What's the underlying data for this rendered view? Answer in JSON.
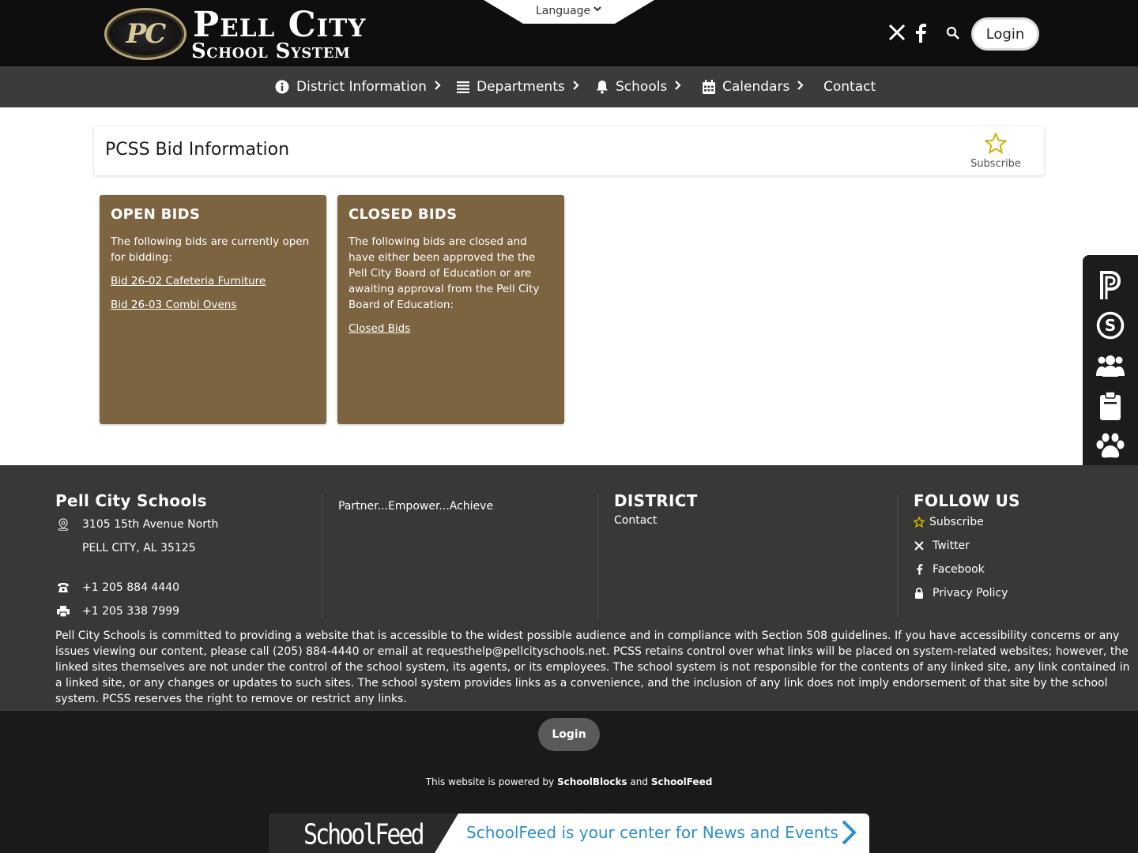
{
  "header": {
    "logo_line1": "Pell City",
    "logo_line2": "School System",
    "logo_seal_text": "PC",
    "language_label": "Language",
    "login_label": "Login"
  },
  "nav": {
    "items": [
      {
        "label": "District Information",
        "icon": "info-circle-icon"
      },
      {
        "label": "Departments",
        "icon": "list-icon"
      },
      {
        "label": "Schools",
        "icon": "bell-icon"
      },
      {
        "label": "Calendars",
        "icon": "calendar-icon"
      },
      {
        "label": "Contact",
        "icon": ""
      }
    ]
  },
  "page": {
    "title": "PCSS Bid Information",
    "subscribe_label": "Subscribe"
  },
  "blocks": [
    {
      "title": "OPEN BIDS",
      "text": "The following bids are currently open for bidding:",
      "links": [
        "Bid 26-02 Cafeteria Furniture",
        "Bid 26-03 Combi Ovens"
      ]
    },
    {
      "title": "CLOSED BIDS",
      "text": "The following bids are closed and have either been approved the the Pell City Board of Education or are awaiting approval from the Pell City Board of Education:",
      "links": [
        "Closed Bids"
      ]
    }
  ],
  "sidebar": {
    "icons": [
      "powerschool-icon",
      "schoolcash-icon",
      "people-icon",
      "clipboard-icon",
      "paw-icon",
      "blocks-icon",
      "apple-icon",
      "gear-icon"
    ]
  },
  "footer": {
    "school_name": "Pell City Schools",
    "address_line1": "3105 15th Avenue North",
    "address_line2": "PELL CITY, AL 35125",
    "phone": "+1 205 884 4440",
    "fax": "+1 205 338 7999",
    "motto": "Partner...Empower...Achieve",
    "district_heading": "DISTRICT",
    "district_links": [
      "Contact"
    ],
    "follow_heading": "FOLLOW US",
    "follow_links": [
      "Subscribe",
      "Twitter",
      "Facebook",
      "Privacy Policy"
    ],
    "disclaimer": "Pell City Schools is committed to providing a website that is accessible to the widest possible audience and in compliance with Section 508 guidelines. If you have accessibility concerns or any issues viewing our content, please call (205) 884-4440 or email at requesthelp@pellcityschools.net. PCSS retains control over what links will be placed on system-related websites; however, the linked sites themselves are not under the control of the school system, its agents, or its employees. The school system is not responsible for the contents of any linked site, any link contained in a linked site, or any changes or updates to such sites. The school system provides links as a convenience, and the inclusion of any link does not imply endorsement of that site by the school system. PCSS reserves the right to remove or restrict any links."
  },
  "bottom": {
    "login_label": "Login",
    "powered_prefix": "This website is powered by",
    "powered_brand1": "SchoolBlocks",
    "powered_and": "and",
    "powered_brand2": "SchoolFeed",
    "schoolfeed_logo": "SchoolFeed",
    "schoolfeed_tagline": "SchoolFeed is your center for News and Events"
  },
  "colors": {
    "header_bg": "#0e0e0e",
    "nav_bg": "#3b3b3b",
    "block_bg": "#7d6440",
    "footer_bg": "#383836",
    "accent_star": "#d4b000",
    "schoolfeed_blue": "#2b8fd0"
  }
}
